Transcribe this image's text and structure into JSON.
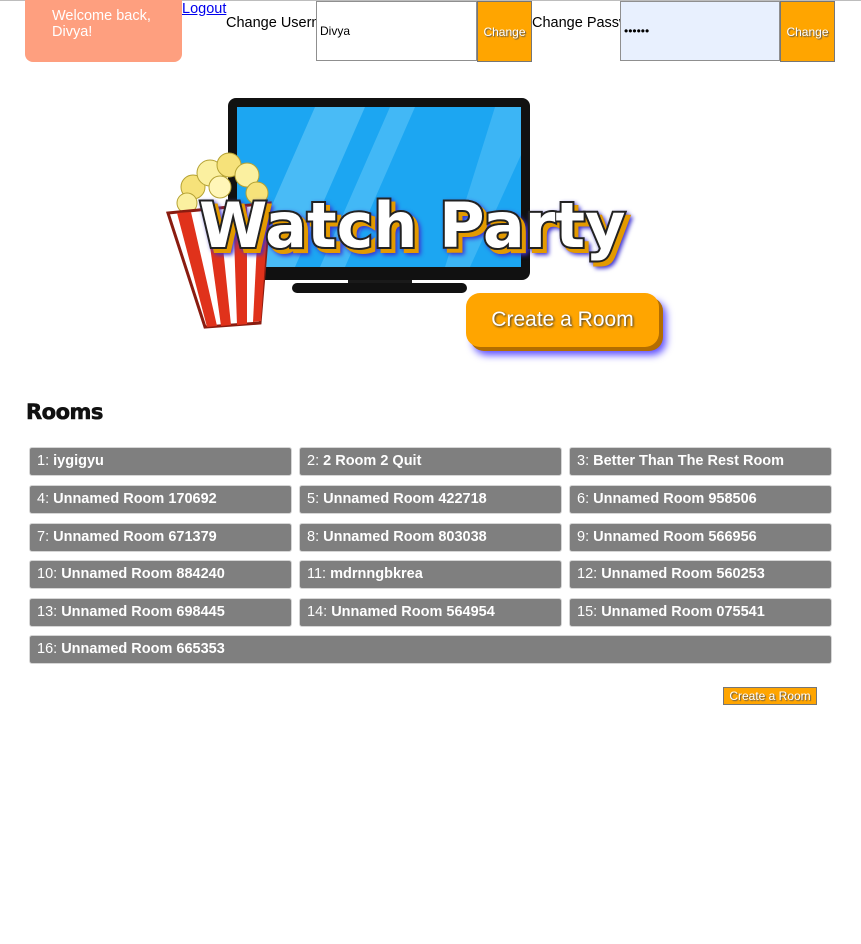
{
  "header": {
    "welcome": "Welcome back, Divya!",
    "logout": "Logout",
    "username": {
      "label": "Change Username:",
      "value": "Divya",
      "button": "Change"
    },
    "password": {
      "label": "Change Password:",
      "value": "••••••",
      "button": "Change"
    }
  },
  "hero": {
    "logo_text": "Watch Party",
    "create_button": "Create a Room"
  },
  "rooms": {
    "title": "Rooms",
    "items": [
      {
        "num": "1:",
        "name": "iygigyu"
      },
      {
        "num": "2:",
        "name": "2 Room 2 Quit"
      },
      {
        "num": "3:",
        "name": "Better Than The Rest Room"
      },
      {
        "num": "4:",
        "name": "Unnamed Room 170692"
      },
      {
        "num": "5:",
        "name": "Unnamed Room 422718"
      },
      {
        "num": "6:",
        "name": "Unnamed Room 958506"
      },
      {
        "num": "7:",
        "name": "Unnamed Room 671379"
      },
      {
        "num": "8:",
        "name": "Unnamed Room 803038"
      },
      {
        "num": "9:",
        "name": "Unnamed Room 566956"
      },
      {
        "num": "10:",
        "name": "Unnamed Room 884240"
      },
      {
        "num": "11:",
        "name": "mdrnngbkrea"
      },
      {
        "num": "12:",
        "name": "Unnamed Room 560253"
      },
      {
        "num": "13:",
        "name": "Unnamed Room 698445"
      },
      {
        "num": "14:",
        "name": "Unnamed Room 564954"
      },
      {
        "num": "15:",
        "name": "Unnamed Room 075541"
      },
      {
        "num": "16:",
        "name": "Unnamed Room 665353"
      }
    ],
    "create_button": "Create a Room"
  },
  "colors": {
    "accent": "#ffa500",
    "welcome_bg": "#fe9f7f",
    "room_bg": "#7f7f7f",
    "link": "#0000ee"
  },
  "icons": [
    "popcorn-icon",
    "tv-icon"
  ]
}
